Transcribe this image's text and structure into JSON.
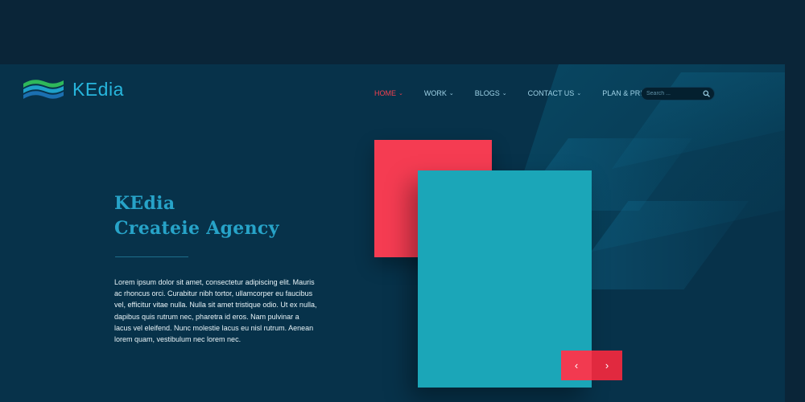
{
  "brand": {
    "name": "KEdia",
    "colors": {
      "accent": "#27b6dd",
      "active": "#f2404f",
      "teal": "#1ba6b8",
      "red": "#f53c52",
      "background": "#07324a"
    }
  },
  "nav": {
    "items": [
      {
        "label": "HOME",
        "active": true
      },
      {
        "label": "WORK",
        "active": false
      },
      {
        "label": "BLOGS",
        "active": false
      },
      {
        "label": "CONTACT US",
        "active": false
      },
      {
        "label": "PLAN & PRICING",
        "active": false
      }
    ],
    "chevron_icon": "chevron-down-icon"
  },
  "search": {
    "placeholder": "Search ...",
    "icon": "search-icon"
  },
  "hero": {
    "title_line1": "KEdia",
    "title_line2": "Createie Agency",
    "body": "Lorem ipsum dolor sit amet, consectetur adipiscing elit. Mauris ac rhoncus orci. Curabitur nibh tortor, ullamcorper eu faucibus vel, efficitur vitae nulla. Nulla sit amet tristique odio. Ut ex nulla, dapibus quis rutrum nec, pharetra id eros. Nam pulvinar a lacus vel eleifend. Nunc molestie lacus eu nisl rutrum. Aenean lorem quam, vestibulum nec lorem nec."
  },
  "slider": {
    "prev_label": "‹",
    "next_label": "›",
    "prev_icon": "chevron-left-icon",
    "next_icon": "chevron-right-icon"
  }
}
